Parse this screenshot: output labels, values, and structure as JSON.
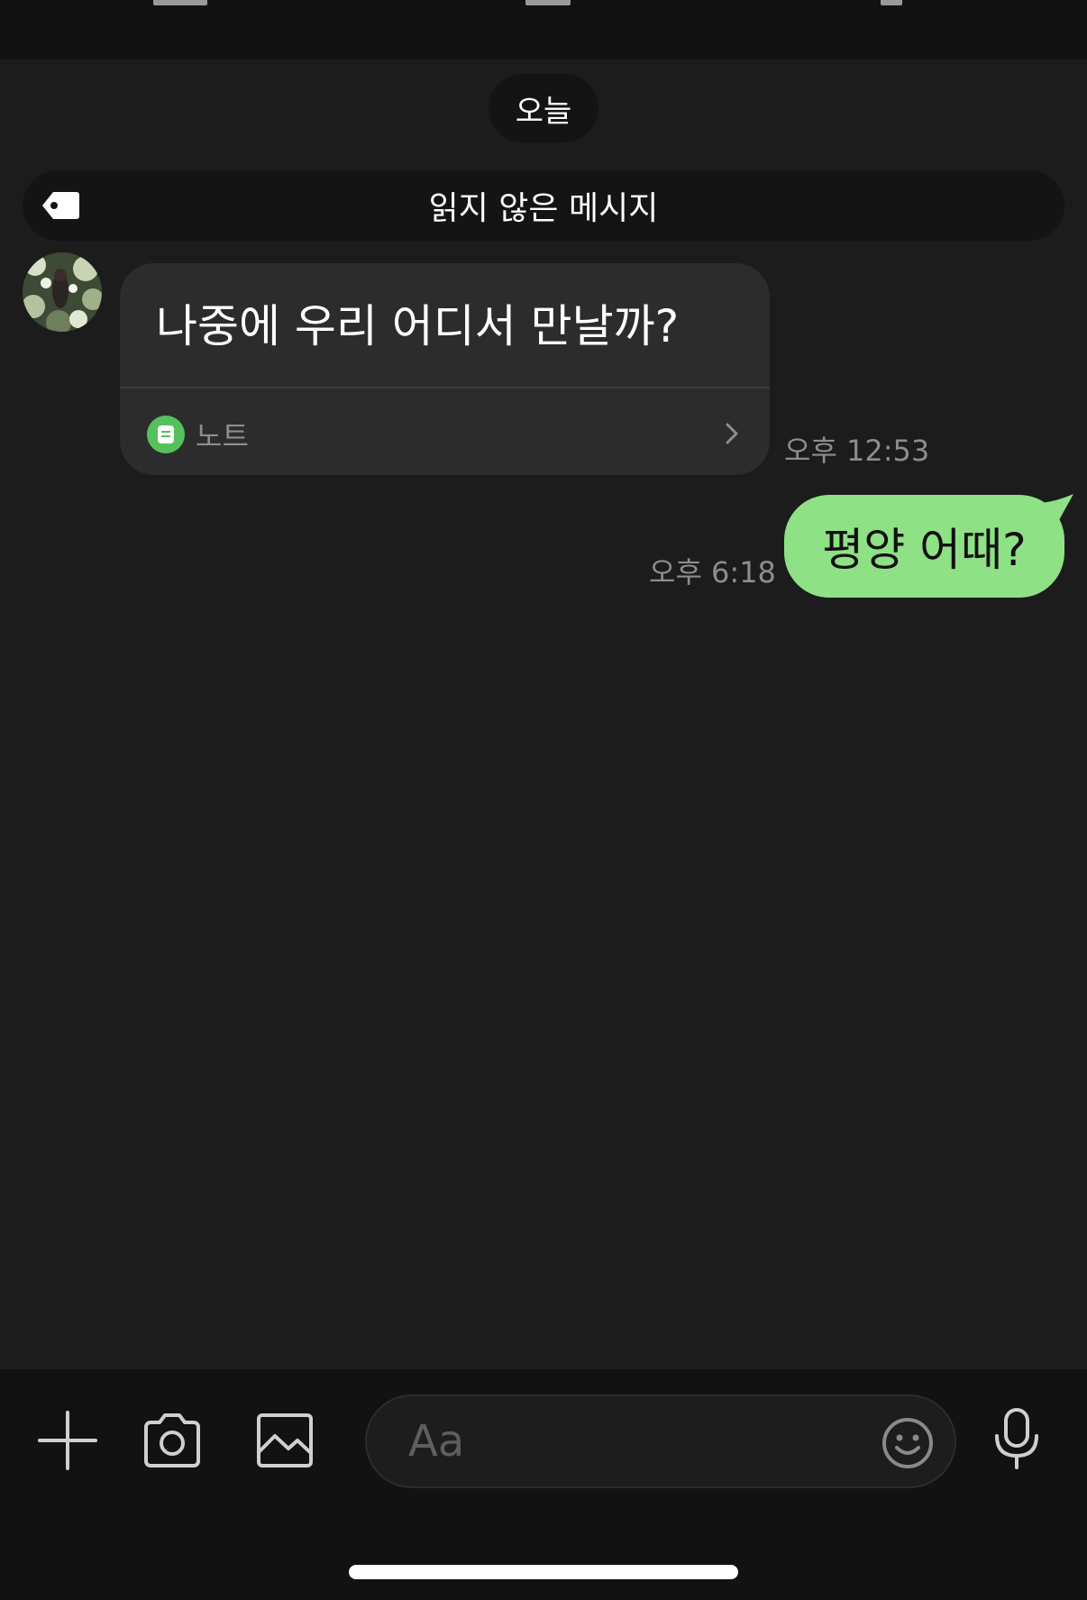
{
  "date_separator": "오늘",
  "unread_banner": {
    "label": "읽지 않은 메시지",
    "icon": "tag-icon"
  },
  "messages": [
    {
      "direction": "incoming",
      "text": "나중에 우리 어디서 만날까?",
      "attachment": {
        "icon": "note-icon",
        "label": "노트",
        "color": "#55c15d"
      },
      "time": "오후 12:53"
    },
    {
      "direction": "outgoing",
      "text": "평양 어때?",
      "time": "오후 6:18",
      "color": "#8fe185"
    }
  ],
  "composer": {
    "placeholder": "Aa",
    "buttons": [
      "plus-icon",
      "camera-icon",
      "image-icon",
      "emoji-icon",
      "microphone-icon"
    ]
  },
  "colors": {
    "background": "#1c1c1c",
    "incoming_bubble": "#2c2c2c",
    "outgoing_bubble": "#8fe185"
  }
}
